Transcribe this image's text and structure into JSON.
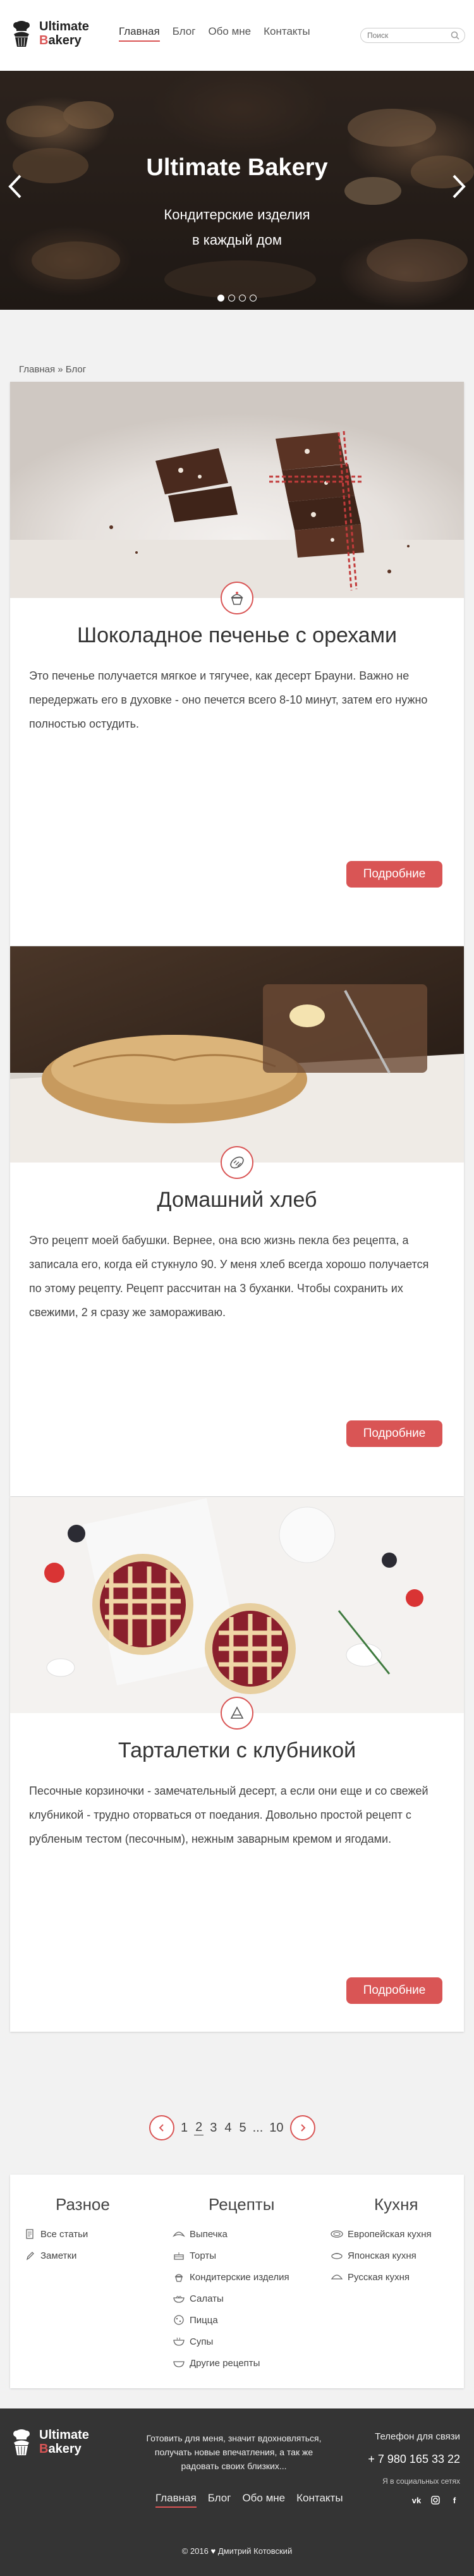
{
  "brand": {
    "line1": "Ultimate",
    "line2_first": "B",
    "line2_rest": "akery"
  },
  "nav": [
    {
      "label": "Главная",
      "active": true
    },
    {
      "label": "Блог",
      "active": false
    },
    {
      "label": "Обо мне",
      "active": false
    },
    {
      "label": "Контакты",
      "active": false
    }
  ],
  "search": {
    "placeholder": "Поиск"
  },
  "hero": {
    "title": "Ultimate Bakery",
    "subtitle_line1": "Кондитерские изделия",
    "subtitle_line2": "в каждый дом",
    "slides": 4,
    "active_slide": 1
  },
  "breadcrumb": {
    "home": "Главная",
    "sep": " » ",
    "current": "Блог"
  },
  "posts": [
    {
      "title": "Шоколадное печенье с орехами",
      "text": "Это печенье получается мягкое и тягучее, как десерт Брауни. Важно не передержать его в духовке - оно печется всего 8-10 минут, затем его нужно полностью остудить.",
      "icon": "cupcake-icon",
      "button": "Подробние"
    },
    {
      "title": "Домашний хлеб",
      "text": "Это рецепт моей бабушки. Вернее, она всю жизнь пекла без рецепта, а записала его, когда ей стукнуло 90. У меня хлеб всегда хорошо получается по этому рецепту. Рецепт рассчитан на 3 буханки. Чтобы сохранить их свежими, 2 я сразу же замораживаю.",
      "icon": "bread-icon",
      "button": "Подробние"
    },
    {
      "title": "Тарталетки с клубникой",
      "text": "Песочные корзиночки - замечательный десерт, а если они еще и со свежей клубникой - трудно оторваться от поедания. Довольно простой рецепт с рубленым тестом (песочным), нежным заварным кремом и ягодами.",
      "icon": "pie-slice-icon",
      "button": "Подробние"
    }
  ],
  "pagination": {
    "pages": [
      "1",
      "2",
      "3",
      "4",
      "5"
    ],
    "current": "2",
    "ellipsis": "...",
    "last": "10"
  },
  "categories": {
    "misc": {
      "title": "Разное",
      "items": [
        {
          "label": "Все статьи",
          "icon": "document-icon"
        },
        {
          "label": "Заметки",
          "icon": "pencil-icon"
        }
      ]
    },
    "recipes": {
      "title": "Рецепты",
      "items": [
        {
          "label": "Выпечка",
          "icon": "croissant-icon"
        },
        {
          "label": "Торты",
          "icon": "cake-icon"
        },
        {
          "label": "Кондитерские изделия",
          "icon": "cupcake-icon"
        },
        {
          "label": "Салаты",
          "icon": "salad-icon"
        },
        {
          "label": "Пицца",
          "icon": "pizza-icon"
        },
        {
          "label": "Супы",
          "icon": "soup-icon"
        },
        {
          "label": "Другие рецепты",
          "icon": "bowl-icon"
        }
      ]
    },
    "cuisine": {
      "title": "Кухня",
      "items": [
        {
          "label": "Европейская кухня",
          "icon": "plate-icon"
        },
        {
          "label": "Японская кухня",
          "icon": "sushi-icon"
        },
        {
          "label": "Русская кухня",
          "icon": "dumpling-icon"
        }
      ]
    }
  },
  "footer": {
    "about_line1": "Готовить для меня, значит вдохновляться,",
    "about_line2": "получать новые впечатления, а так же",
    "about_line3": "радовать своих близких...",
    "phone_label": "Телефон для связи",
    "phone": "+ 7 980 165 33 22",
    "social_label": "Я в социальных сетях",
    "social": [
      "vk",
      "instagram",
      "facebook"
    ],
    "copyright_year": "© 2016",
    "copyright_name": "Дмитрий Котовский"
  },
  "colors": {
    "accent": "#d95555",
    "footer_bg": "#343434",
    "page_bg": "#f2f2f2"
  }
}
